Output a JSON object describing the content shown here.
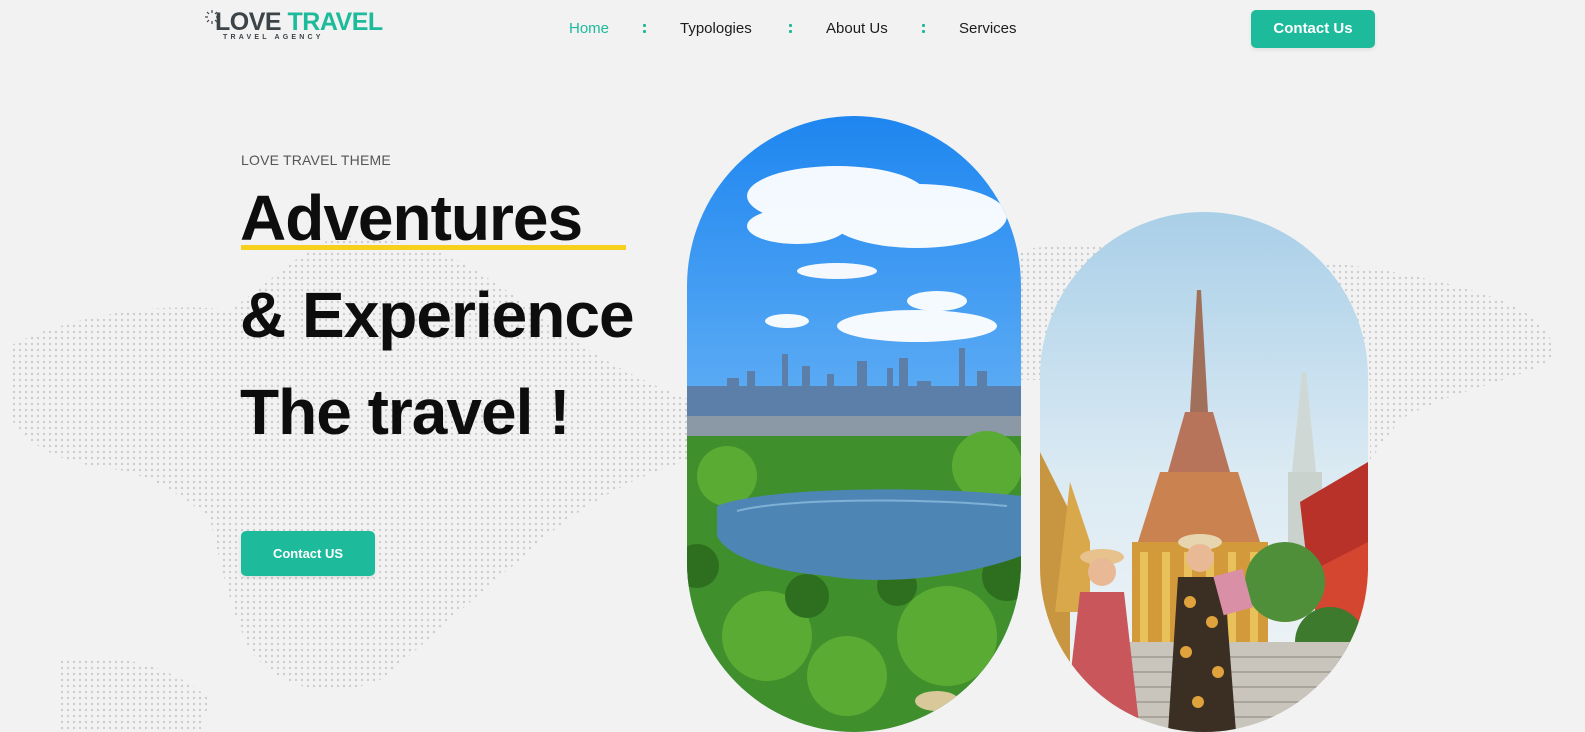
{
  "header": {
    "logo": {
      "brand_part1": "LOVE",
      "brand_part2": "TRAVEL",
      "tagline": "TRAVEL AGENCY"
    },
    "nav": [
      {
        "label": "Home",
        "active": true
      },
      {
        "label": "Typologies",
        "active": false
      },
      {
        "label": "About Us",
        "active": false
      },
      {
        "label": "Services",
        "active": false
      }
    ],
    "cta_label": "Contact Us"
  },
  "hero": {
    "eyebrow": "LOVE TRAVEL THEME",
    "headline_line1": "Adventures",
    "headline_line2": "& Experience",
    "headline_line3": "The travel !",
    "cta_label": "Contact US"
  },
  "images": [
    {
      "name": "city-park-photo",
      "icon": "central-park-skyline"
    },
    {
      "name": "temple-photo",
      "icon": "temple-travelers"
    }
  ],
  "colors": {
    "accent": "#1dbb9b",
    "highlight": "#f7cf1d",
    "background": "#f2f2f2",
    "text": "#0d0d0d"
  }
}
